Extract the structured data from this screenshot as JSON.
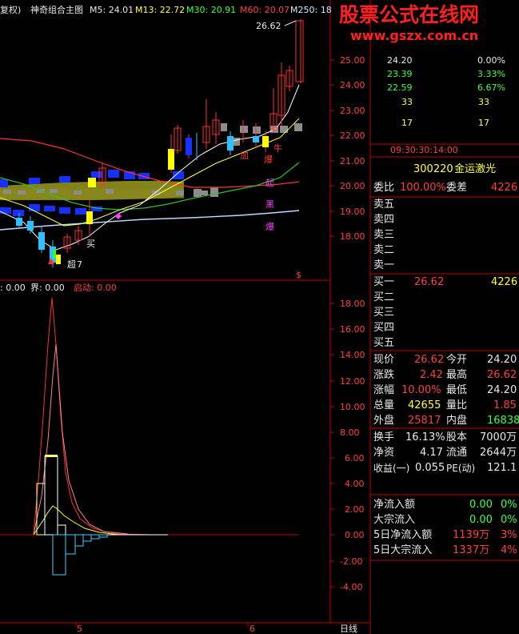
{
  "header": {
    "fq": "复权)",
    "title": "神奇组合主图",
    "m5": "M5: 24.01",
    "m13": "M13: 22.72",
    "m30": "M30: 20.91",
    "m60": "M60: 20.07",
    "m250": "M250: 18"
  },
  "watermark": {
    "cn": "股票公式在线网",
    "url": "www.gszx.com.cn"
  },
  "price_axis": [
    "25.00",
    "24.00",
    "23.00",
    "22.00",
    "21.00",
    "20.00",
    "19.00",
    "18.00"
  ],
  "high_label": "26.62",
  "chart_marks": {
    "niu": "牛",
    "bao1": "爆",
    "qi": "起",
    "hei": "黑",
    "bao2": "爆",
    "jia": "加",
    "mai": "买",
    "chao": "超",
    "seven": "7",
    "s": "$"
  },
  "indicator_header": {
    "a": ": 0.00",
    "b": "界: 0.00",
    "c": "启动: 0.00"
  },
  "indicator_axis": [
    "18.00",
    "16.00",
    "14.00",
    "12.00",
    "10.00",
    "8.00",
    "6.00",
    "4.00",
    "2.00",
    "0.00",
    "-2.00",
    "-4.00"
  ],
  "x_axis": {
    "d1": "5",
    "d2": "6",
    "period": "日线"
  },
  "mini": {
    "rows": [
      {
        "p": "24.20",
        "pct": "0.00%"
      },
      {
        "p": "23.39",
        "pct": "3.33%"
      },
      {
        "p": "22.59",
        "pct": "6.67%"
      },
      {
        "p": "33",
        "pct": "33"
      },
      {
        "p": "17",
        "pct": "17"
      }
    ],
    "time": "09:30:30:14:00"
  },
  "quote": {
    "code": "300220",
    "name": "金运激光",
    "wb_label": "委比",
    "wb": "100.00%",
    "wc_label": "委差",
    "wc": "4226",
    "sells": [
      "卖五",
      "卖四",
      "卖三",
      "卖二",
      "卖一"
    ],
    "buys": [
      {
        "l": "买一",
        "p": "26.62",
        "v": "4226"
      },
      {
        "l": "买二",
        "p": "",
        "v": ""
      },
      {
        "l": "买三",
        "p": "",
        "v": ""
      },
      {
        "l": "买四",
        "p": "",
        "v": ""
      },
      {
        "l": "买五",
        "p": "",
        "v": ""
      }
    ],
    "stats": [
      {
        "l1": "现价",
        "v1": "26.62",
        "l2": "今开",
        "v2": "24.20"
      },
      {
        "l1": "涨跌",
        "v1": "2.42",
        "l2": "最高",
        "v2": "26.62"
      },
      {
        "l1": "涨幅",
        "v1": "10.00%",
        "l2": "最低",
        "v2": "24.20"
      },
      {
        "l1": "总量",
        "v1": "42655",
        "l2": "量比",
        "v2": "1.85"
      },
      {
        "l1": "外盘",
        "v1": "25817",
        "l2": "内盘",
        "v2": "16838"
      }
    ],
    "fin": [
      {
        "l1": "换手",
        "v1": "16.13%",
        "l2": "股本",
        "v2": "7000万"
      },
      {
        "l1": "净资",
        "v1": "4.17",
        "l2": "流通",
        "v2": "2644万"
      },
      {
        "l1": "收益(一)",
        "v1": "0.055",
        "l2": "PE(动)",
        "v2": "121.1"
      }
    ],
    "flow": [
      {
        "l": "净流入额",
        "v": "0.00",
        "p": "0%"
      },
      {
        "l": "大宗流入",
        "v": "0.00",
        "p": "0%"
      },
      {
        "l": "5日净流入额",
        "v": "1139万",
        "p": "3%"
      },
      {
        "l": "5日大宗流入",
        "v": "1337万",
        "p": "4%"
      }
    ]
  },
  "colors": {
    "up": "#ff4040",
    "down": "#40ff40",
    "grid": "#c00000"
  }
}
